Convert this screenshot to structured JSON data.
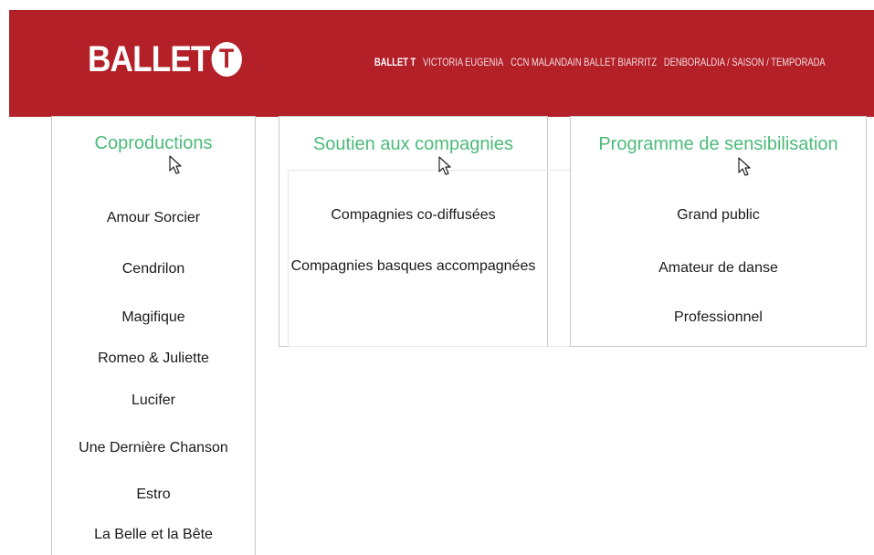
{
  "header": {
    "logo_text": "BALLET",
    "logo_letter": "T",
    "nav": [
      "BALLET T",
      "VICTORIA EUGENIA",
      "CCN MALANDAIN BALLET BIARRITZ",
      "DENBORALDIA / SAISON / TEMPORADA"
    ]
  },
  "coproductions": {
    "title": "Coproductions",
    "items": [
      "Amour Sorcier",
      "Cendrilon",
      "Magifique",
      "Romeo & Juliette",
      "Lucifer",
      "Une Dernière Chanson",
      "Estro",
      "La Belle et la Bête"
    ]
  },
  "soutien": {
    "title": "Soutien aux compagnies",
    "items": [
      "Compagnies co-diffusées",
      "Compagnies basques accompagnées"
    ]
  },
  "programme": {
    "title": "Programme de sensibilisation",
    "items": [
      "Grand public",
      "Amateur de danse",
      "Professionnel"
    ]
  },
  "colors": {
    "header_bg": "#b32028",
    "title_green": "#4cbb7a"
  }
}
